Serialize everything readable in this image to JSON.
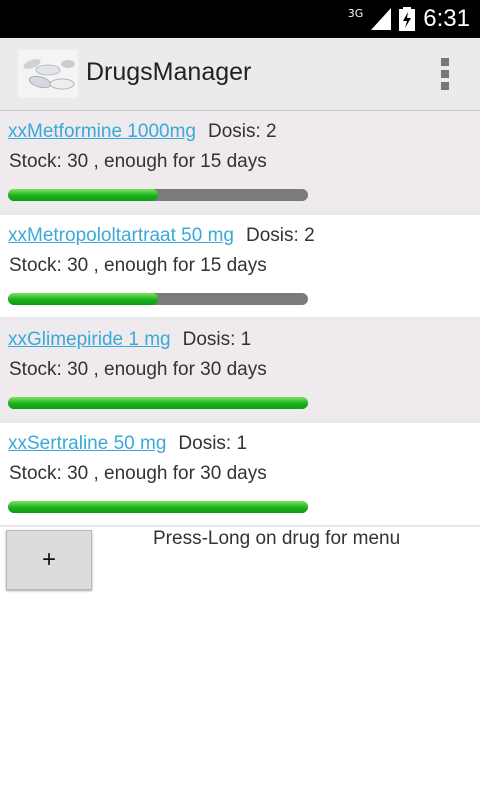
{
  "status_bar": {
    "network": "3G",
    "signal_icon": "signal-bars-icon",
    "battery_icon": "battery-charging-icon",
    "time": "6:31"
  },
  "action_bar": {
    "app_icon": "pills-icon",
    "title": "DrugsManager",
    "overflow_icon": "overflow-menu-icon"
  },
  "drugs": [
    {
      "name": "xxMetformine 1000mg",
      "dosis": "Dosis: 2",
      "stock": "Stock: 30 , enough for 15 days",
      "progress": 0.5
    },
    {
      "name": "xxMetropololtartraat 50 mg",
      "dosis": "Dosis: 2",
      "stock": "Stock: 30 , enough for 15 days",
      "progress": 0.5
    },
    {
      "name": "xxGlimepiride 1 mg",
      "dosis": "Dosis: 1",
      "stock": "Stock: 30 , enough for 30 days",
      "progress": 1.0
    },
    {
      "name": "xxSertraline 50 mg",
      "dosis": "Dosis: 1",
      "stock": "Stock: 30 , enough for 30 days",
      "progress": 1.0
    }
  ],
  "add_button": {
    "label": "+"
  },
  "hint": "Press-Long on drug for menu",
  "colors": {
    "progress_green": "#18b11d",
    "progress_gray": "#7b7b7b",
    "link_blue": "#3aa9d9",
    "row_alt": "#efeaee"
  }
}
